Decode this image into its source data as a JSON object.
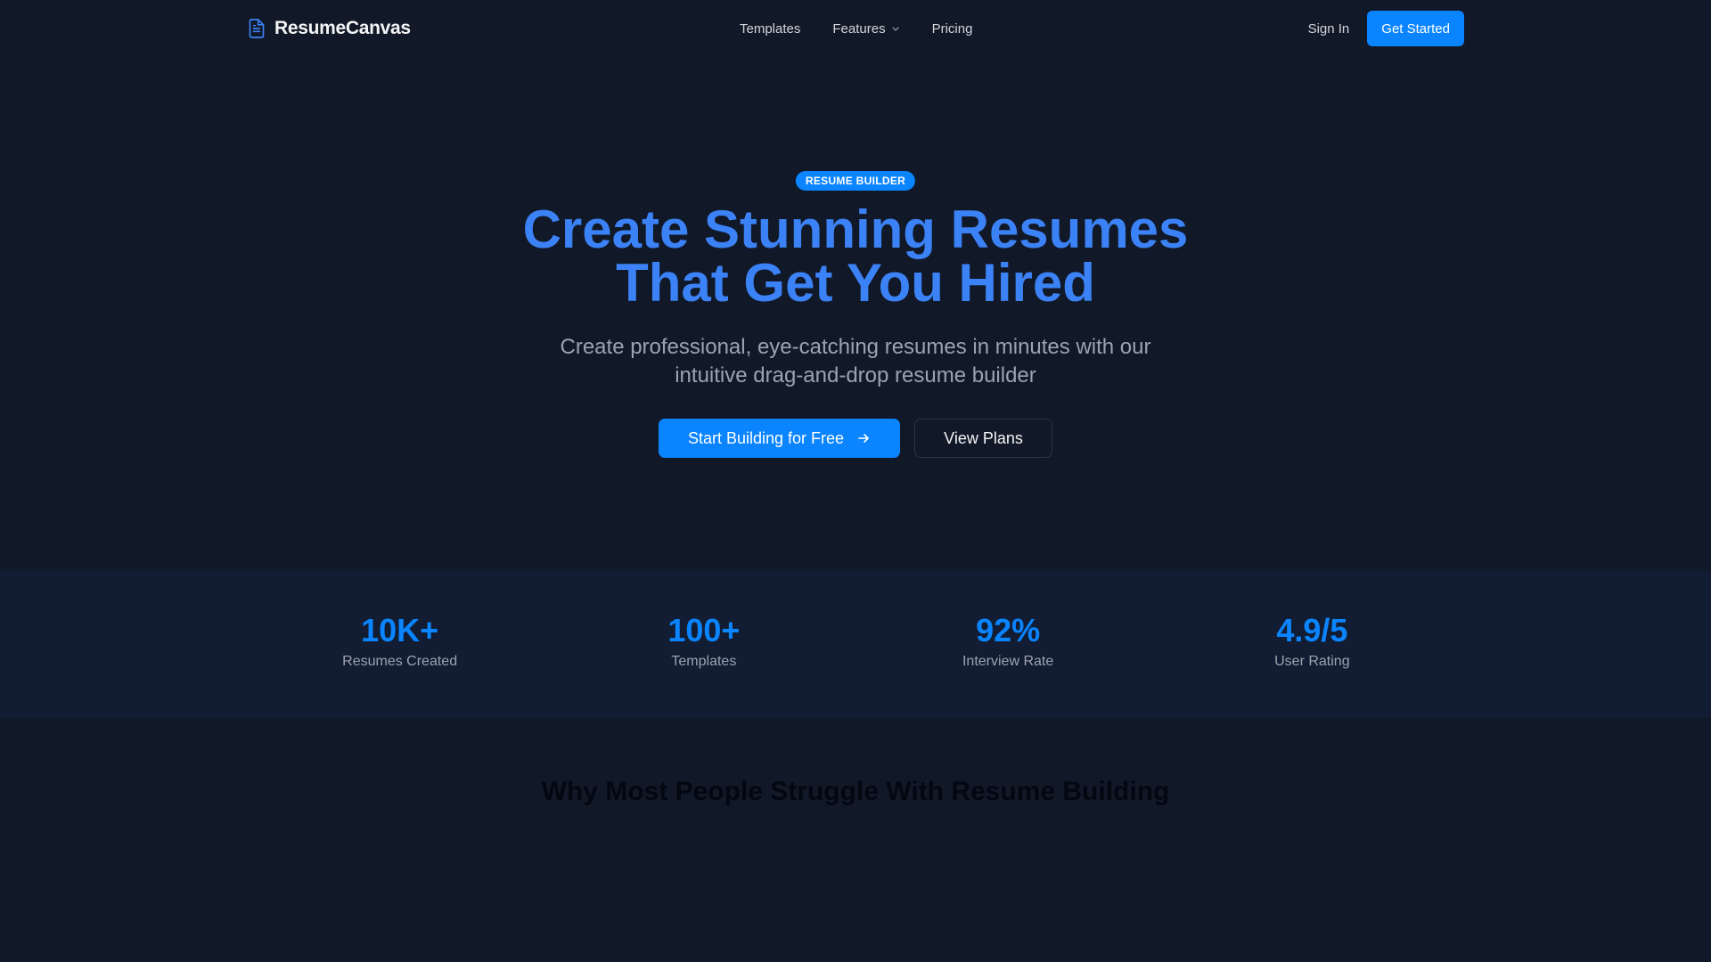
{
  "nav": {
    "brand": "ResumeCanvas",
    "links": [
      {
        "label": "Templates"
      },
      {
        "label": "Features"
      },
      {
        "label": "Pricing"
      }
    ],
    "sign_in": "Sign In",
    "get_started": "Get Started"
  },
  "hero": {
    "badge": "RESUME BUILDER",
    "title_line1": "Create Stunning Resumes",
    "title_line2": "That Get You Hired",
    "subtitle_line1": "Create professional, eye-catching resumes in minutes with our",
    "subtitle_line2": "intuitive drag-and-drop resume builder",
    "primary_cta": "Start Building for Free",
    "secondary_cta": "View Plans"
  },
  "stats": [
    {
      "value": "10K+",
      "label": "Resumes Created"
    },
    {
      "value": "100+",
      "label": "Templates"
    },
    {
      "value": "92%",
      "label": "Interview Rate"
    },
    {
      "value": "4.9/5",
      "label": "User Rating"
    }
  ],
  "struggle": {
    "title": "Why Most People Struggle With Resume Building"
  },
  "colors": {
    "background": "#111827",
    "accent": "#0a84ff",
    "headline": "#3b82f6",
    "stats_band": "#121d33"
  },
  "icons": {
    "brand": "document-icon",
    "features_dropdown": "chevron-down-icon",
    "cta_arrow": "arrow-right-icon"
  }
}
